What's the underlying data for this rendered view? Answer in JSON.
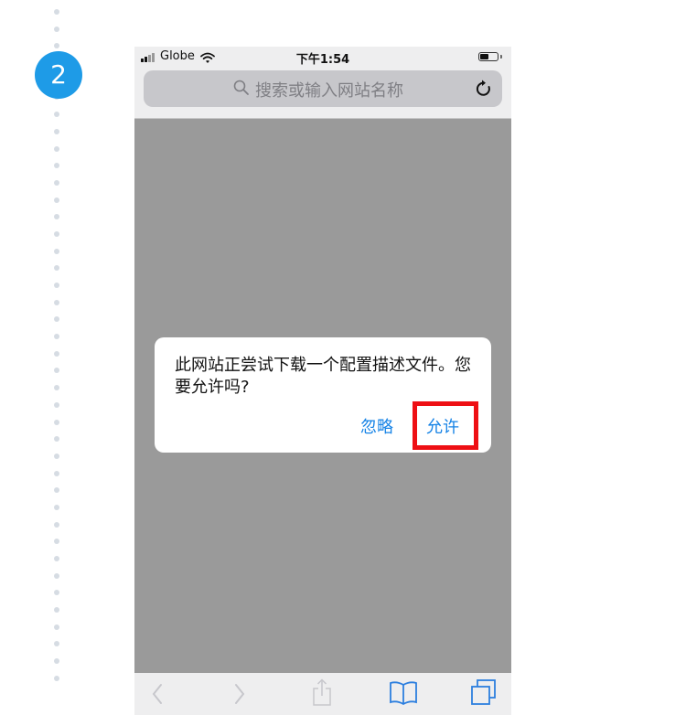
{
  "step": {
    "number": "2"
  },
  "status_bar": {
    "carrier": "Globe",
    "time": "下午1:54"
  },
  "url_bar": {
    "placeholder": "搜索或输入网站名称"
  },
  "dialog": {
    "message": "此网站正尝试下载一个配置描述文件。您要允许吗?",
    "ignore_label": "忽略",
    "allow_label": "允许",
    "highlight_color": "#ee0f14"
  },
  "toolbar": {
    "items": [
      "back-icon",
      "forward-icon",
      "share-icon",
      "bookmarks-icon",
      "tabs-icon"
    ]
  },
  "colors": {
    "badge": "#1e9be7",
    "ios_blue": "#1683e6",
    "dim_overlay": "#9a9a9a"
  }
}
